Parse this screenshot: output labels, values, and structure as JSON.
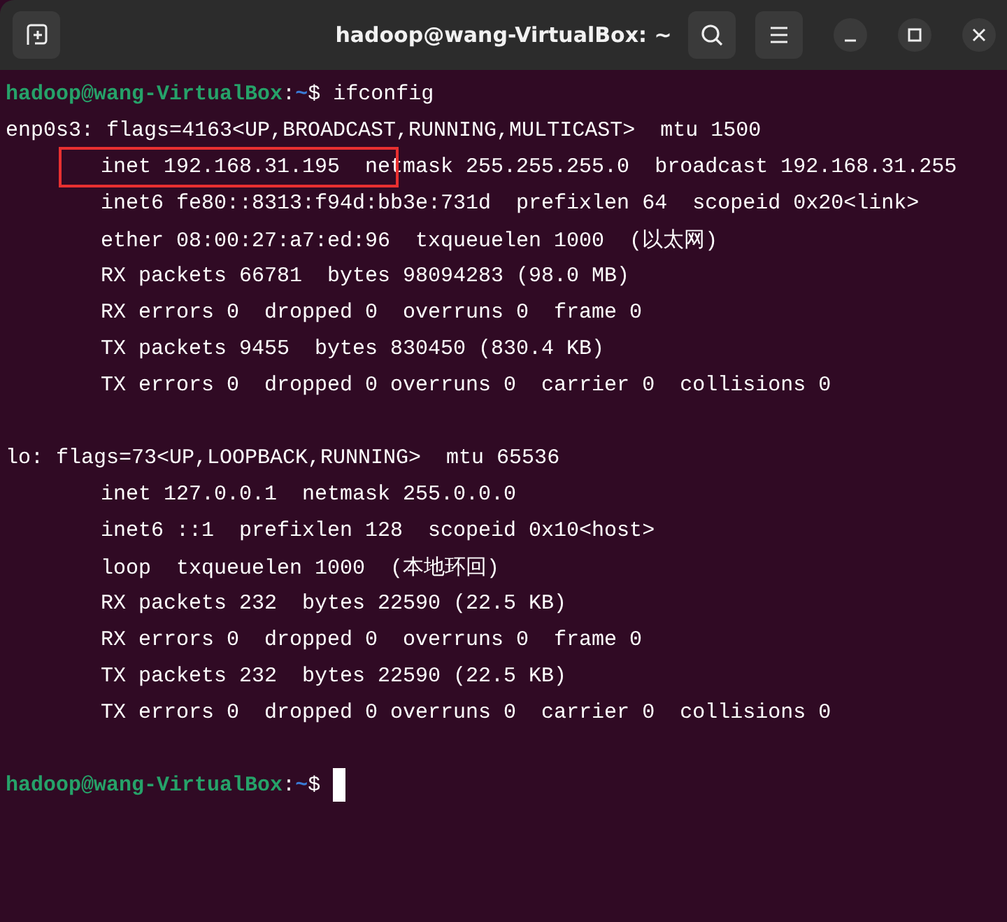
{
  "window": {
    "title": "hadoop@wang-VirtualBox: ~"
  },
  "terminal": {
    "lines": [
      {
        "kind": "prompt",
        "user": "hadoop@wang-VirtualBox",
        "separator": ":",
        "path": "~",
        "symbol": "$",
        "command": "ifconfig"
      },
      {
        "kind": "header",
        "text": "enp0s3: flags=4163<UP,BROADCAST,RUNNING,MULTICAST>  mtu 1500"
      },
      {
        "kind": "detail",
        "text": "inet 192.168.31.195  netmask 255.255.255.0  broadcast 192.168.31.255",
        "boxed": true
      },
      {
        "kind": "detail",
        "text": "inet6 fe80::8313:f94d:bb3e:731d  prefixlen 64  scopeid 0x20<link>",
        "boxed": false
      },
      {
        "kind": "detail",
        "text": "ether 08:00:27:a7:ed:96  txqueuelen 1000  (以太网)",
        "boxed": false
      },
      {
        "kind": "detail",
        "text": "RX packets 66781  bytes 98094283 (98.0 MB)",
        "boxed": false
      },
      {
        "kind": "detail",
        "text": "RX errors 0  dropped 0  overruns 0  frame 0",
        "boxed": false
      },
      {
        "kind": "detail",
        "text": "TX packets 9455  bytes 830450 (830.4 KB)",
        "boxed": false
      },
      {
        "kind": "detail",
        "text": "TX errors 0  dropped 0 overruns 0  carrier 0  collisions 0",
        "boxed": false
      },
      {
        "kind": "blank"
      },
      {
        "kind": "header",
        "text": "lo: flags=73<UP,LOOPBACK,RUNNING>  mtu 65536"
      },
      {
        "kind": "detail",
        "text": "inet 127.0.0.1  netmask 255.0.0.0",
        "boxed": false
      },
      {
        "kind": "detail",
        "text": "inet6 ::1  prefixlen 128  scopeid 0x10<host>",
        "boxed": false
      },
      {
        "kind": "detail",
        "text": "loop  txqueuelen 1000  (本地环回)",
        "boxed": false
      },
      {
        "kind": "detail",
        "text": "RX packets 232  bytes 22590 (22.5 KB)",
        "boxed": false
      },
      {
        "kind": "detail",
        "text": "RX errors 0  dropped 0  overruns 0  frame 0",
        "boxed": false
      },
      {
        "kind": "detail",
        "text": "TX packets 232  bytes 22590 (22.5 KB)",
        "boxed": false
      },
      {
        "kind": "detail",
        "text": "TX errors 0  dropped 0 overruns 0  carrier 0  collisions 0",
        "boxed": false
      },
      {
        "kind": "blank"
      },
      {
        "kind": "prompt",
        "user": "hadoop@wang-VirtualBox",
        "separator": ":",
        "path": "~",
        "symbol": "$",
        "cursor": true
      }
    ]
  }
}
